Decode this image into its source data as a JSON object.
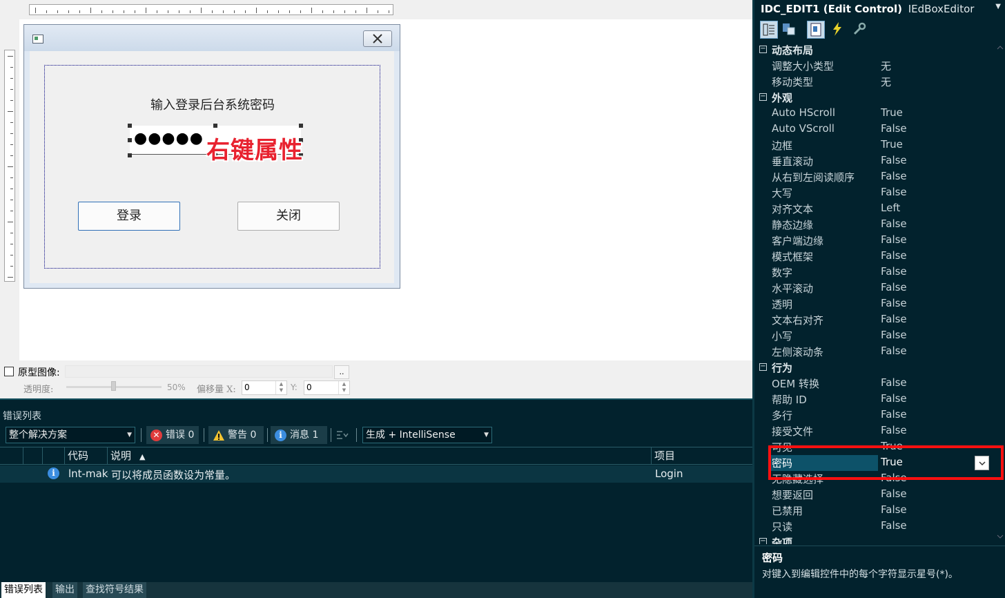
{
  "designer": {
    "prompt_label": "输入登录后台系统密码",
    "password_masked": "●●●●●",
    "annotation": "右键属性",
    "login_button": "登录",
    "close_button": "关闭"
  },
  "proto": {
    "label": "原型图像:",
    "browse": "..",
    "opacity_label": "透明度:",
    "opacity_value": "50%",
    "opacity_fraction": 0.5,
    "offset_label": "偏移量 X:",
    "x_value": "0",
    "y_label": "Y:",
    "y_value": "0"
  },
  "error_list": {
    "title": "错误列表",
    "scope": "整个解决方案",
    "errors": "错误 0",
    "warnings": "警告 0",
    "messages": "消息 1",
    "build": "生成 + IntelliSense",
    "columns": {
      "code": "代码",
      "desc": "说明",
      "project": "项目"
    },
    "row": {
      "code": "lnt-make-member-function-const",
      "desc": "可以将成员函数设为常量。",
      "project": "Login"
    }
  },
  "tabs": {
    "errors": "错误列表",
    "output": "输出",
    "find": "查找符号结果"
  },
  "props": {
    "object": "IDC_EDIT1 (Edit Control)",
    "editor": "IEdBoxEditor",
    "groups": [
      {
        "name": "动态布局",
        "items": [
          {
            "name": "调整大小类型",
            "value": "无"
          },
          {
            "name": "移动类型",
            "value": "无"
          }
        ]
      },
      {
        "name": "外观",
        "items": [
          {
            "name": "Auto HScroll",
            "value": "True"
          },
          {
            "name": "Auto VScroll",
            "value": "False"
          },
          {
            "name": "边框",
            "value": "True"
          },
          {
            "name": "垂直滚动",
            "value": "False"
          },
          {
            "name": "从右到左阅读顺序",
            "value": "False"
          },
          {
            "name": "大写",
            "value": "False"
          },
          {
            "name": "对齐文本",
            "value": "Left"
          },
          {
            "name": "静态边缘",
            "value": "False"
          },
          {
            "name": "客户端边缘",
            "value": "False"
          },
          {
            "name": "模式框架",
            "value": "False"
          },
          {
            "name": "数字",
            "value": "False"
          },
          {
            "name": "水平滚动",
            "value": "False"
          },
          {
            "name": "透明",
            "value": "False"
          },
          {
            "name": "文本右对齐",
            "value": "False"
          },
          {
            "name": "小写",
            "value": "False"
          },
          {
            "name": "左侧滚动条",
            "value": "False"
          }
        ]
      },
      {
        "name": "行为",
        "items": [
          {
            "name": "OEM 转换",
            "value": "False"
          },
          {
            "name": "帮助 ID",
            "value": "False"
          },
          {
            "name": "多行",
            "value": "False"
          },
          {
            "name": "接受文件",
            "value": "False"
          },
          {
            "name": "可见",
            "value": "True"
          },
          {
            "name": "密码",
            "value": "True"
          },
          {
            "name": "无隐藏选择",
            "value": "False"
          },
          {
            "name": "想要返回",
            "value": "False"
          },
          {
            "name": "已禁用",
            "value": "False"
          },
          {
            "name": "只读",
            "value": "False"
          }
        ]
      },
      {
        "name": "杂项",
        "items": []
      }
    ],
    "desc_title": "密码",
    "desc_text": "对键入到编辑控件中的每个字符显示星号(*)。"
  },
  "colors": {
    "accent": "#0d5269",
    "highlight": "#ff1010",
    "annotation": "#e8222f",
    "dark_bg": "#02222d"
  }
}
